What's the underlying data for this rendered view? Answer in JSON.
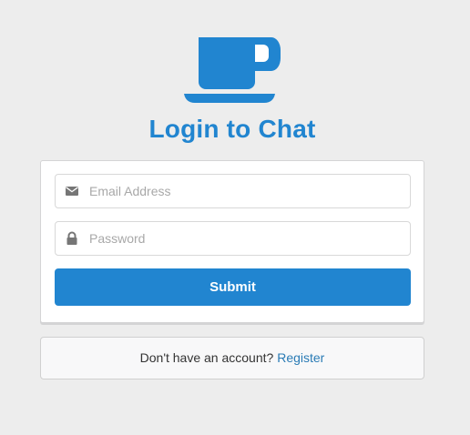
{
  "header": {
    "logo_icon": "coffee-cup-icon",
    "title": "Login to Chat"
  },
  "form": {
    "email": {
      "icon": "envelope-icon",
      "placeholder": "Email Address",
      "value": ""
    },
    "password": {
      "icon": "lock-icon",
      "placeholder": "Password",
      "value": ""
    },
    "submit_label": "Submit"
  },
  "footer": {
    "prompt": "Don't have an account?",
    "register_label": "Register"
  },
  "colors": {
    "primary": "#2185d0",
    "background": "#ededed",
    "link": "#2a7bb5"
  }
}
